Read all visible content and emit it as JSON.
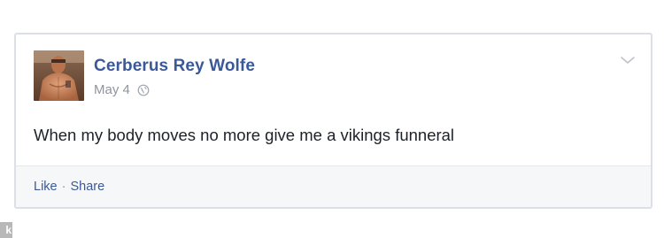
{
  "post": {
    "author": "Cerberus Rey Wolfe",
    "date": "May 4",
    "privacy_icon": "globe-icon",
    "menu_icon": "chevron-down-icon",
    "text": "When my body moves no more give me a vikings funneral"
  },
  "footer": {
    "like_label": "Like",
    "separator": "·",
    "share_label": "Share"
  },
  "watermark": {
    "text": "k"
  },
  "colors": {
    "link_blue": "#3b5998",
    "meta_gray": "#90949c",
    "body_text": "#1d2129",
    "footer_bg": "#f6f7f9",
    "card_border": "#dcdfe6"
  }
}
